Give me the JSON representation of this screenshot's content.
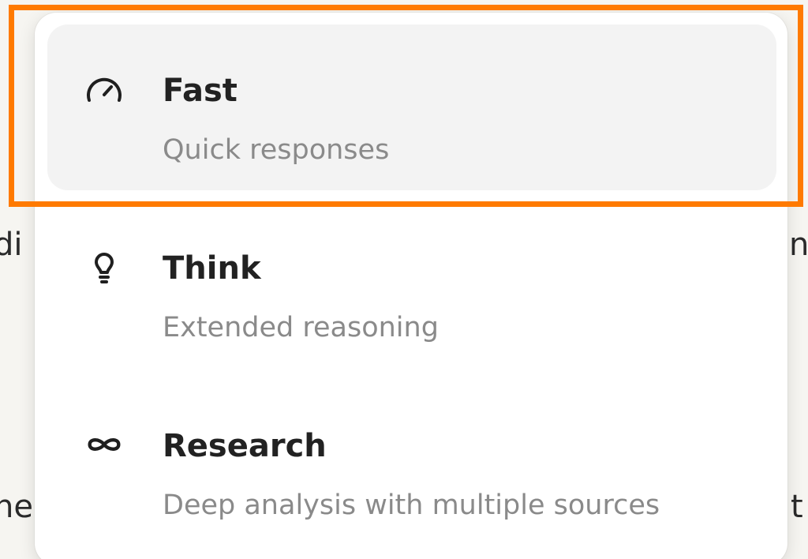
{
  "background": {
    "left_fragment_1": "di",
    "right_fragment_1": "n",
    "left_fragment_2": "he",
    "right_fragment_2": "t"
  },
  "menu": {
    "items": [
      {
        "title": "Fast",
        "description": "Quick responses",
        "icon": "speedometer-icon",
        "selected": true
      },
      {
        "title": "Think",
        "description": "Extended reasoning",
        "icon": "lightbulb-icon",
        "selected": false
      },
      {
        "title": "Research",
        "description": "Deep analysis with multiple sources",
        "icon": "infinity-icon",
        "selected": false
      }
    ]
  },
  "colors": {
    "highlight": "#ff7a00",
    "selected_background": "#f3f3f3",
    "title_text": "#222222",
    "description_text": "#8a8a8a"
  }
}
